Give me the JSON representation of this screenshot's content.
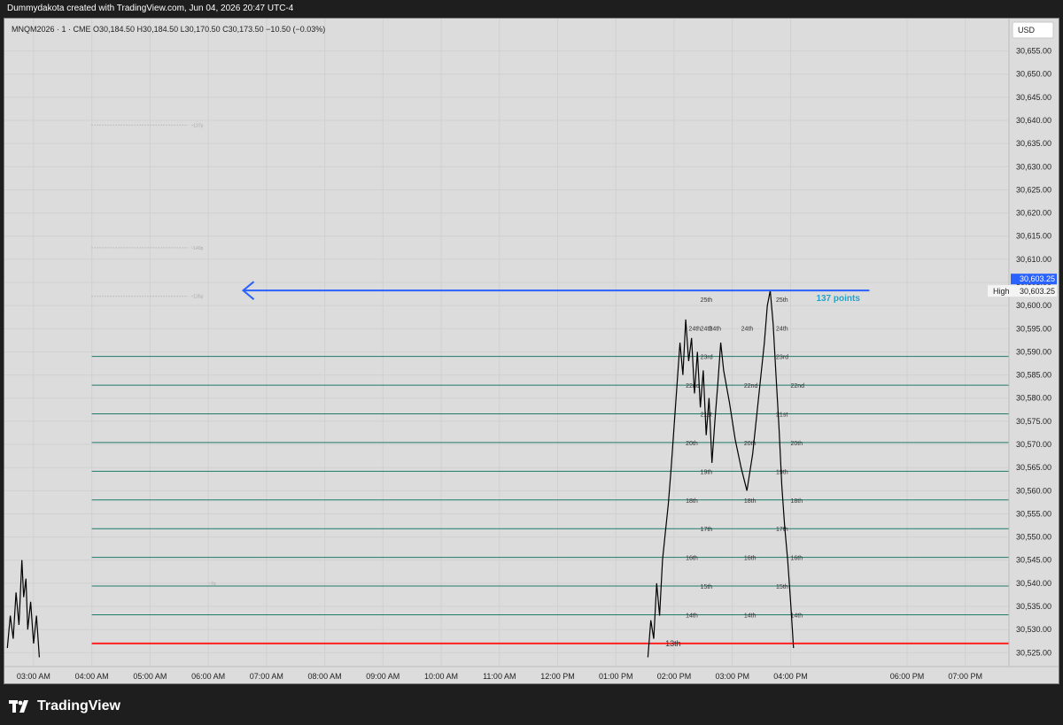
{
  "header": {
    "created_text": "Dummydakota created with TradingView.com, Jun 04, 2026 20:47 UTC-4"
  },
  "footer": {
    "brand": "TradingView"
  },
  "colors": {
    "background": "#dcdcdc",
    "level_line": "#1f7a6a",
    "red_line": "#ff2020",
    "arrow": "#2962ff",
    "annotation": "#26a0c8",
    "price_badge": "#2962ff"
  },
  "chart_data": {
    "type": "line",
    "symbol_info": "MNQM2026 · 1 · CME  O30,184.50  H30,184.50  L30,170.50  C30,173.50  −10.50 (−0.03%)",
    "currency": "USD",
    "ylim": [
      30522,
      30662
    ],
    "y_ticks": [
      30525,
      30530,
      30535,
      30540,
      30545,
      30550,
      30555,
      30560,
      30565,
      30570,
      30575,
      30580,
      30585,
      30590,
      30595,
      30600,
      30605,
      30610,
      30615,
      30620,
      30625,
      30630,
      30635,
      30640,
      30645,
      30650,
      30655
    ],
    "y_tick_labels": [
      "30,525.00",
      "30,530.00",
      "30,535.00",
      "30,540.00",
      "30,545.00",
      "30,550.00",
      "30,555.00",
      "30,560.00",
      "30,565.00",
      "30,570.00",
      "30,575.00",
      "30,580.00",
      "30,585.00",
      "30,590.00",
      "30,595.00",
      "30,600.00",
      "30,605.00",
      "30,610.00",
      "30,615.00",
      "30,620.00",
      "30,625.00",
      "30,630.00",
      "30,635.00",
      "30,640.00",
      "30,645.00",
      "30,650.00",
      "30,655.00"
    ],
    "x_range_hours": [
      2.5,
      19.75
    ],
    "x_tick_hours": [
      3,
      4,
      5,
      6,
      7,
      8,
      9,
      10,
      11,
      12,
      13,
      14,
      15,
      16,
      18,
      19
    ],
    "x_tick_labels": [
      "03:00 AM",
      "04:00 AM",
      "05:00 AM",
      "06:00 AM",
      "07:00 AM",
      "08:00 AM",
      "09:00 AM",
      "10:00 AM",
      "11:00 AM",
      "12:00 PM",
      "01:00 PM",
      "02:00 PM",
      "03:00 PM",
      "04:00 PM",
      "06:00 PM",
      "07:00 PM"
    ],
    "current_price_label": "30,603.25",
    "high_label": "High",
    "high_value_label": "30,603.25",
    "high_price": 30603.25,
    "arrow": {
      "price": 30603.25,
      "from_hour": 15.68,
      "to_hour": 6.6
    },
    "annotation": "137 points",
    "red_line": {
      "price": 30527,
      "label": "13th"
    },
    "levels": [
      {
        "price": 30533.2,
        "label": "14th"
      },
      {
        "price": 30539.4,
        "label": "15th"
      },
      {
        "price": 30545.6,
        "label": "16th"
      },
      {
        "price": 30551.8,
        "label": "17th"
      },
      {
        "price": 30558.0,
        "label": "18th"
      },
      {
        "price": 30564.2,
        "label": "19th"
      },
      {
        "price": 30570.4,
        "label": "20th"
      },
      {
        "price": 30576.6,
        "label": "21st"
      },
      {
        "price": 30582.8,
        "label": "22nd"
      },
      {
        "price": 30589.0,
        "label": "23rd"
      }
    ],
    "upper_labels": [
      {
        "price": 30595.2,
        "label": "24th"
      },
      {
        "price": 30601.4,
        "label": "25th"
      }
    ],
    "series": [
      {
        "values": [
          [
            2.55,
            30526
          ],
          [
            2.6,
            30533
          ],
          [
            2.65,
            30528
          ],
          [
            2.7,
            30538
          ],
          [
            2.75,
            30531
          ],
          [
            2.8,
            30545
          ],
          [
            2.83,
            30537
          ],
          [
            2.87,
            30541
          ],
          [
            2.9,
            30530
          ],
          [
            2.95,
            30536
          ],
          [
            3.0,
            30527
          ],
          [
            3.05,
            30533
          ],
          [
            3.1,
            30524
          ],
          [
            13.55,
            30524
          ],
          [
            13.6,
            30532
          ],
          [
            13.65,
            30528
          ],
          [
            13.7,
            30540
          ],
          [
            13.75,
            30533
          ],
          [
            13.8,
            30545
          ],
          [
            13.85,
            30551
          ],
          [
            13.9,
            30557
          ],
          [
            13.95,
            30565
          ],
          [
            14.0,
            30574
          ],
          [
            14.05,
            30583
          ],
          [
            14.1,
            30592
          ],
          [
            14.15,
            30585
          ],
          [
            14.2,
            30597
          ],
          [
            14.25,
            30588
          ],
          [
            14.3,
            30593
          ],
          [
            14.35,
            30581
          ],
          [
            14.4,
            30590
          ],
          [
            14.45,
            30578
          ],
          [
            14.5,
            30586
          ],
          [
            14.55,
            30572
          ],
          [
            14.6,
            30580
          ],
          [
            14.65,
            30566
          ],
          [
            14.7,
            30575
          ],
          [
            14.75,
            30583
          ],
          [
            14.8,
            30592
          ],
          [
            14.85,
            30586
          ],
          [
            14.95,
            30579
          ],
          [
            15.05,
            30571
          ],
          [
            15.15,
            30565
          ],
          [
            15.25,
            30560
          ],
          [
            15.35,
            30568
          ],
          [
            15.45,
            30580
          ],
          [
            15.55,
            30592
          ],
          [
            15.6,
            30600
          ],
          [
            15.65,
            30603.25
          ],
          [
            15.7,
            30596
          ],
          [
            15.75,
            30585
          ],
          [
            15.8,
            30574
          ],
          [
            15.85,
            30561
          ],
          [
            15.9,
            30552
          ],
          [
            15.95,
            30545
          ],
          [
            16.0,
            30536
          ],
          [
            16.05,
            30526
          ]
        ]
      }
    ],
    "faint_labels": [
      "~137p",
      "~140p",
      "~135p",
      "~7p"
    ]
  }
}
